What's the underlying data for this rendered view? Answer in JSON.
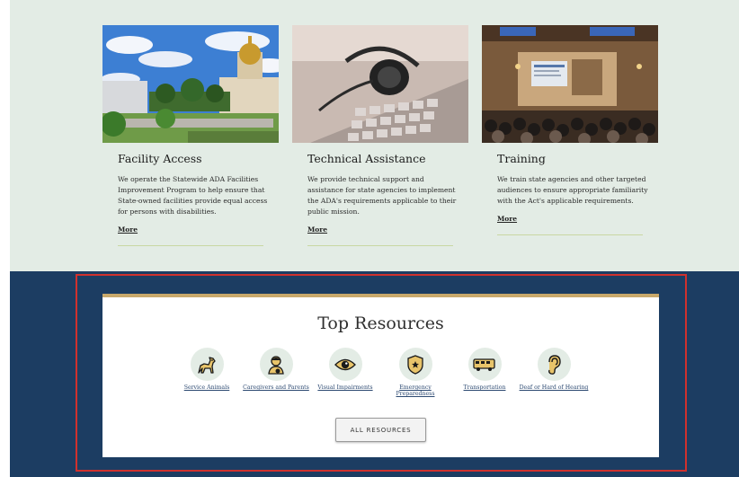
{
  "cards": [
    {
      "title": "Facility Access",
      "description": "We operate the Statewide ADA Facilities Improvement Program to help ensure that State-owned facilities provide equal access for persons with disabilities.",
      "more": "More"
    },
    {
      "title": "Technical Assistance",
      "description": "We provide technical support and assistance for state agencies to implement the ADA's requirements applicable to their public mission.",
      "more": "More"
    },
    {
      "title": "Training",
      "description": "We train state agencies and other targeted audiences to ensure appropriate familiarity with the Act's applicable requirements.",
      "more": "More"
    }
  ],
  "resources": {
    "heading": "Top Resources",
    "items": [
      {
        "label": "Service Animals",
        "icon": "dog-icon"
      },
      {
        "label": "Caregivers and Parents",
        "icon": "caregiver-icon"
      },
      {
        "label": "Visual Impairments",
        "icon": "eye-icon"
      },
      {
        "label": "Emergency Preparedness",
        "icon": "shield-icon"
      },
      {
        "label": "Transportation",
        "icon": "bus-icon"
      },
      {
        "label": "Deaf or Hard of Hearing",
        "icon": "ear-icon"
      }
    ],
    "all_button": "ALL RESOURCES"
  },
  "colors": {
    "top_band": "#e3ece5",
    "bottom_band": "#1c3d62",
    "accent_gold": "#c8a96b",
    "icon_fill": "#e8c46a",
    "highlight": "#d0312d"
  }
}
